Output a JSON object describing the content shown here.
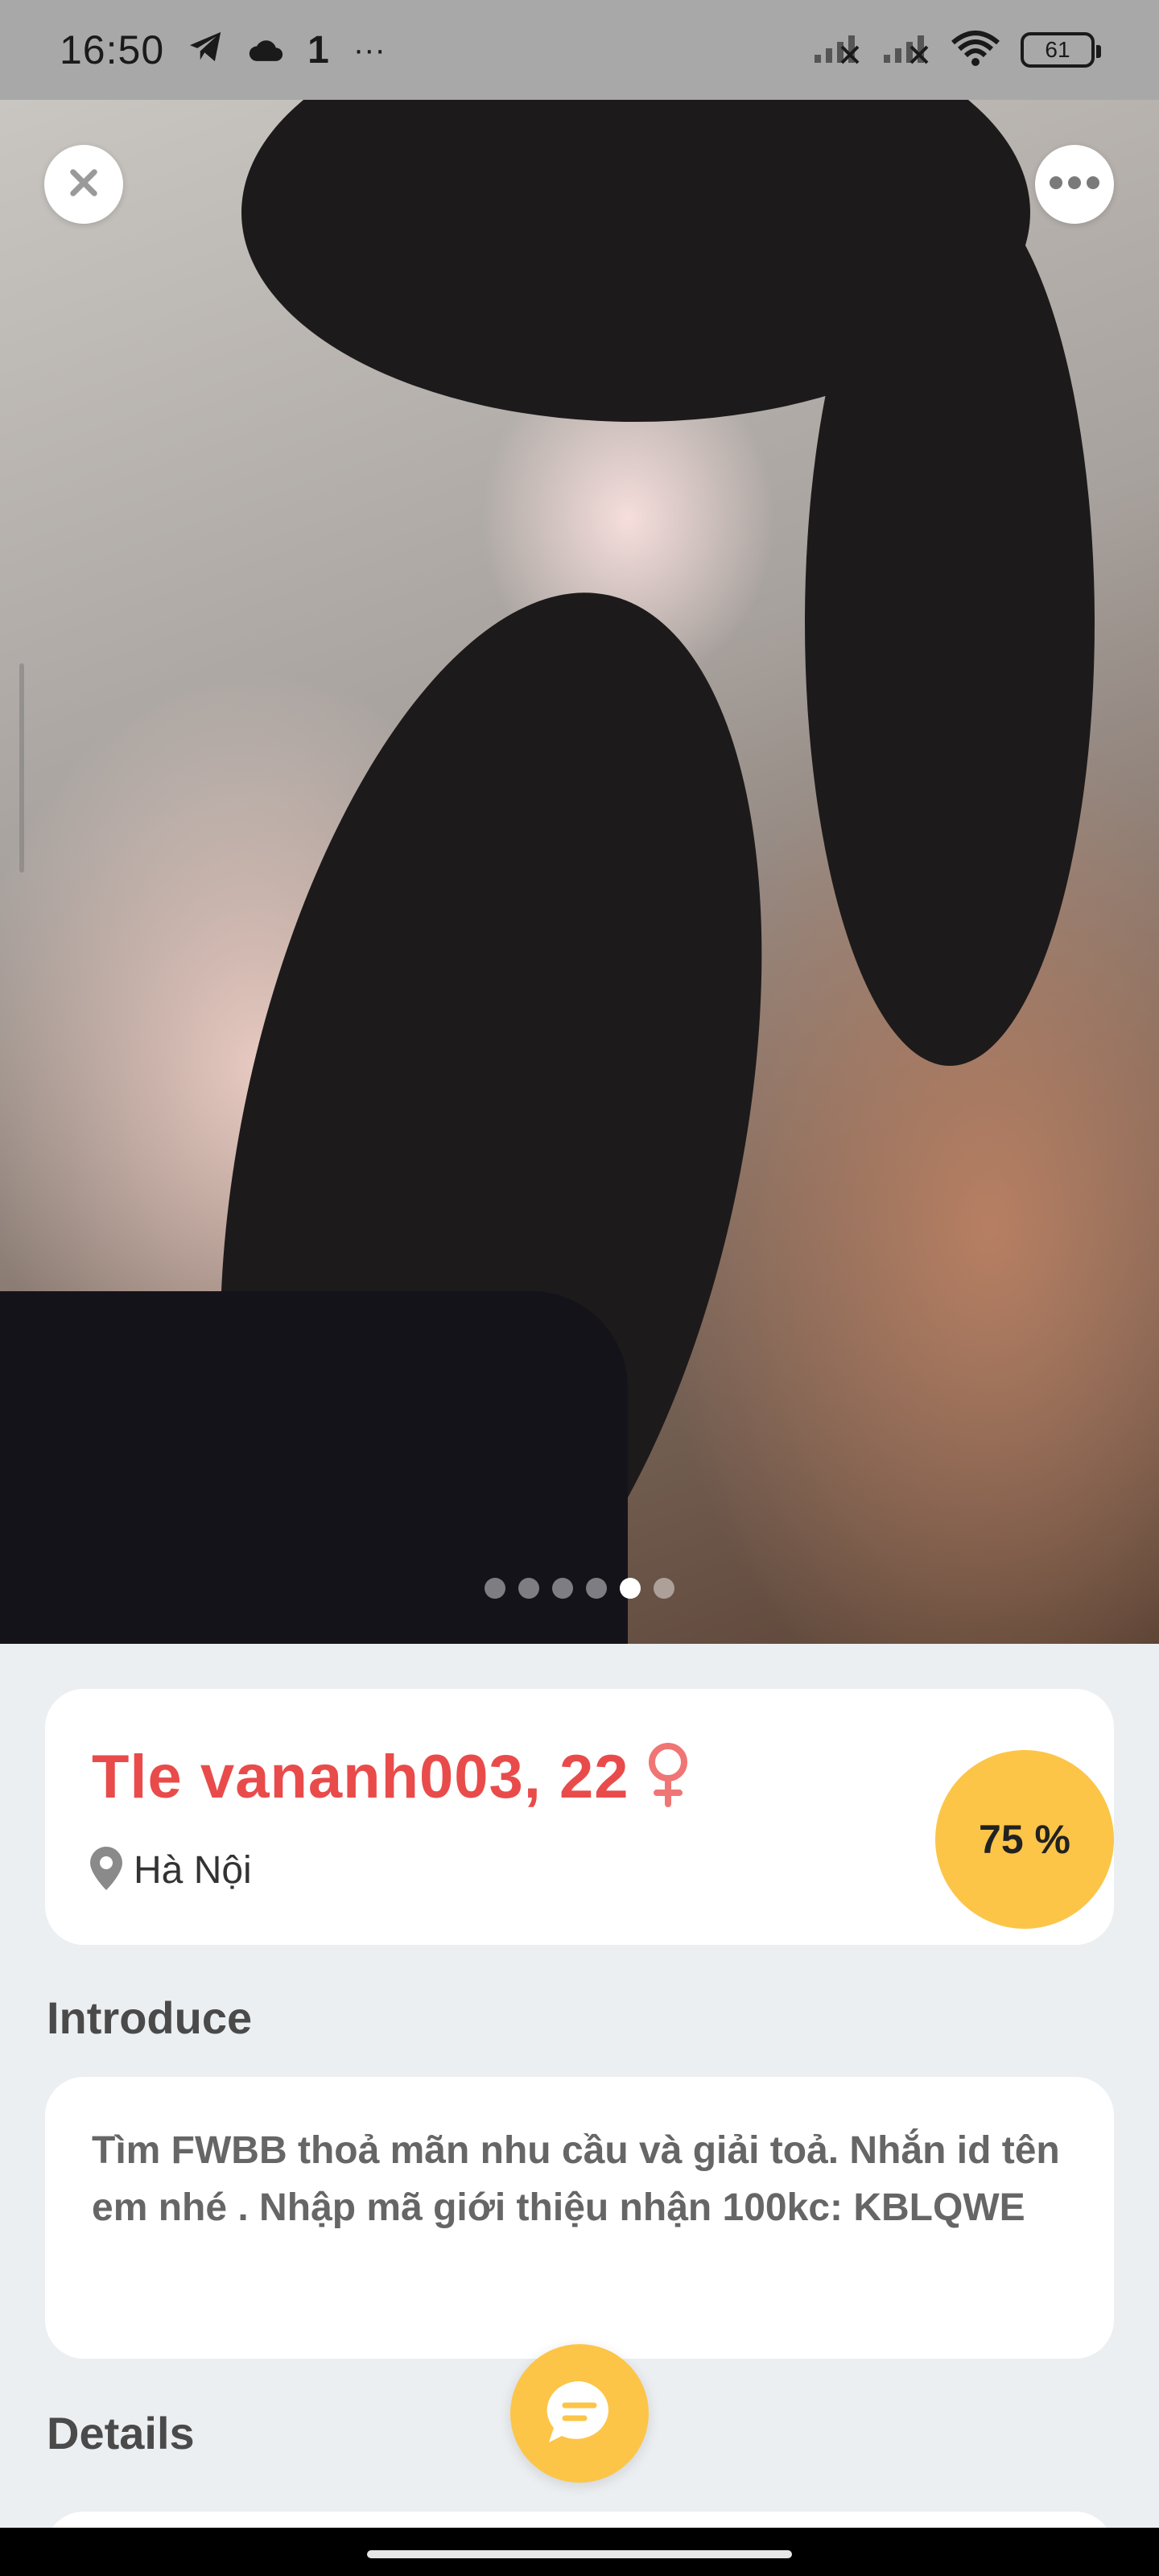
{
  "status_bar": {
    "time": "16:50",
    "extra": "1",
    "more": "···",
    "battery": "61"
  },
  "photo": {
    "close_icon": "close-icon",
    "more_icon": "more-icon",
    "image_count": 6,
    "active_index": 4
  },
  "profile": {
    "name_age": "Tle vananh003, 22",
    "gender_symbol": "♀",
    "location": "Hà Nội",
    "match": "75 %"
  },
  "introduce": {
    "title": "Introduce",
    "text": "Tìm FWBB thoả mãn nhu cầu và giải toả. Nhắn id tên em nhé . Nhập mã giới thiệu nhận 100kc: KBLQWE"
  },
  "details": {
    "title": "Details"
  },
  "colors": {
    "accent_red": "#e94b4b",
    "accent_yellow": "#fcc547"
  }
}
